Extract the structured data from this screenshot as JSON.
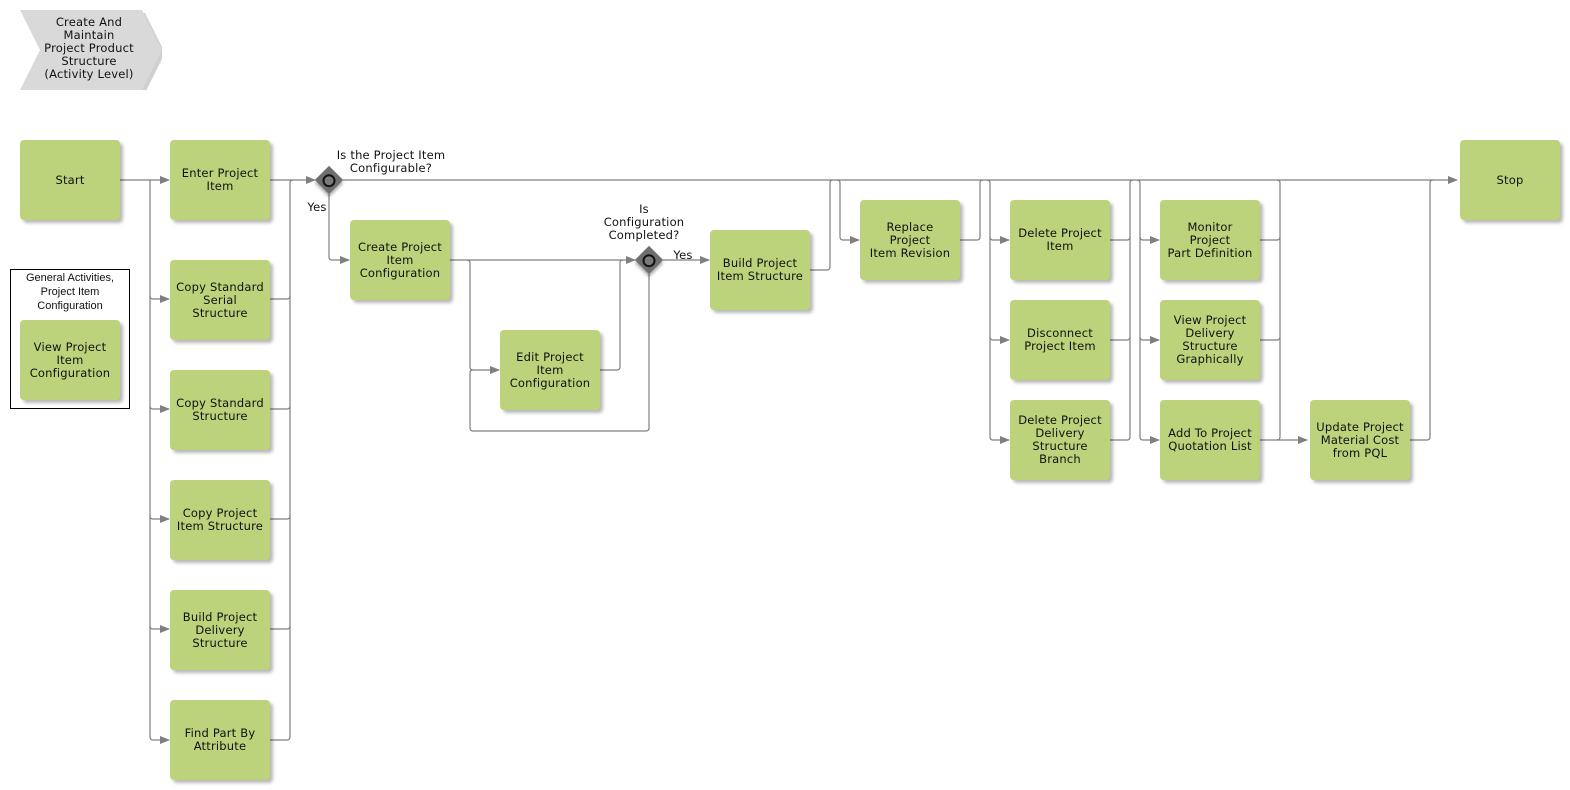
{
  "diagram": {
    "title": "Create And\nMaintain\nProject Product\nStructure\n(Activity Level)",
    "colors": {
      "activity_fill": "#bcd37c",
      "gateway_fill": "#6e6e6e",
      "connector": "#7f7f7f",
      "title_fill": "#d9d9d9"
    },
    "group": {
      "label": "General Activities,\nProject Item\nConfiguration",
      "activity": "View Project\nItem\nConfiguration"
    },
    "activities": {
      "start": "Start",
      "enter_project_item": "Enter Project\nItem",
      "copy_standard_serial_structure": "Copy Standard\nSerial Structure",
      "copy_standard_structure": "Copy Standard\nStructure",
      "copy_project_item_structure": "Copy Project\nItem Structure",
      "build_project_delivery_structure": "Build Project\nDelivery\nStructure",
      "find_part_by_attribute": "Find Part By\nAttribute",
      "create_project_item_configuration": "Create Project\nItem\nConfiguration",
      "edit_project_item_configuration": "Edit Project\nItem\nConfiguration",
      "build_project_item_structure": "Build Project\nItem Structure",
      "replace_project_item_revision": "Replace Project\nItem Revision",
      "delete_project_item": "Delete Project\nItem",
      "disconnect_project_item": "Disconnect\nProject Item",
      "delete_project_delivery_structure_branch": "Delete Project\nDelivery\nStructure\nBranch",
      "monitor_project_part_definition": "Monitor Project\nPart Definition",
      "view_project_delivery_structure_graphically": "View Project\nDelivery\nStructure\nGraphically",
      "add_to_project_quotation_list": "Add To Project\nQuotation List",
      "update_project_material_cost_from_pql": "Update Project\nMaterial Cost\nfrom PQL",
      "stop": "Stop"
    },
    "gateways": {
      "configurable": {
        "question": "Is the Project Item\nConfigurable?",
        "branch_label": "Yes"
      },
      "completed": {
        "question": "Is\nConfiguration\nCompleted?",
        "branch_label": "Yes"
      }
    }
  }
}
